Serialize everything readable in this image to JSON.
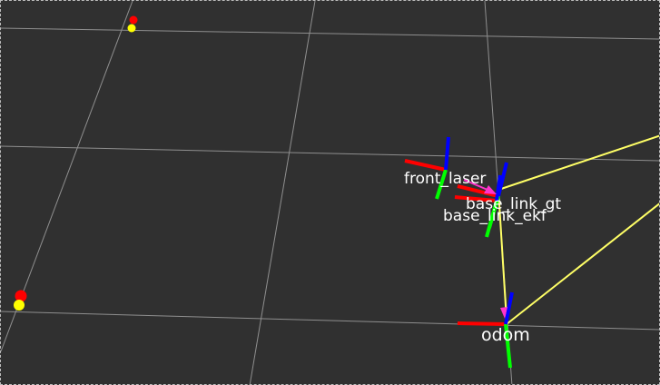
{
  "view": {
    "background_color": "#303030",
    "grid_color": "#8f8f8f",
    "border": "dashed"
  },
  "colors": {
    "x_axis": "#ff0000",
    "y_axis": "#00ff00",
    "z_axis": "#0000ff",
    "tf_arrow": "#ff33cc",
    "path_line": "#ffff66",
    "marker_top": "#ff0000",
    "marker_bottom": "#ffff00"
  },
  "frames": {
    "front_laser": "front_laser",
    "base_link_gt": "base_link_gt",
    "base_link_ekf": "base_link_ekf",
    "odom": "odom"
  }
}
